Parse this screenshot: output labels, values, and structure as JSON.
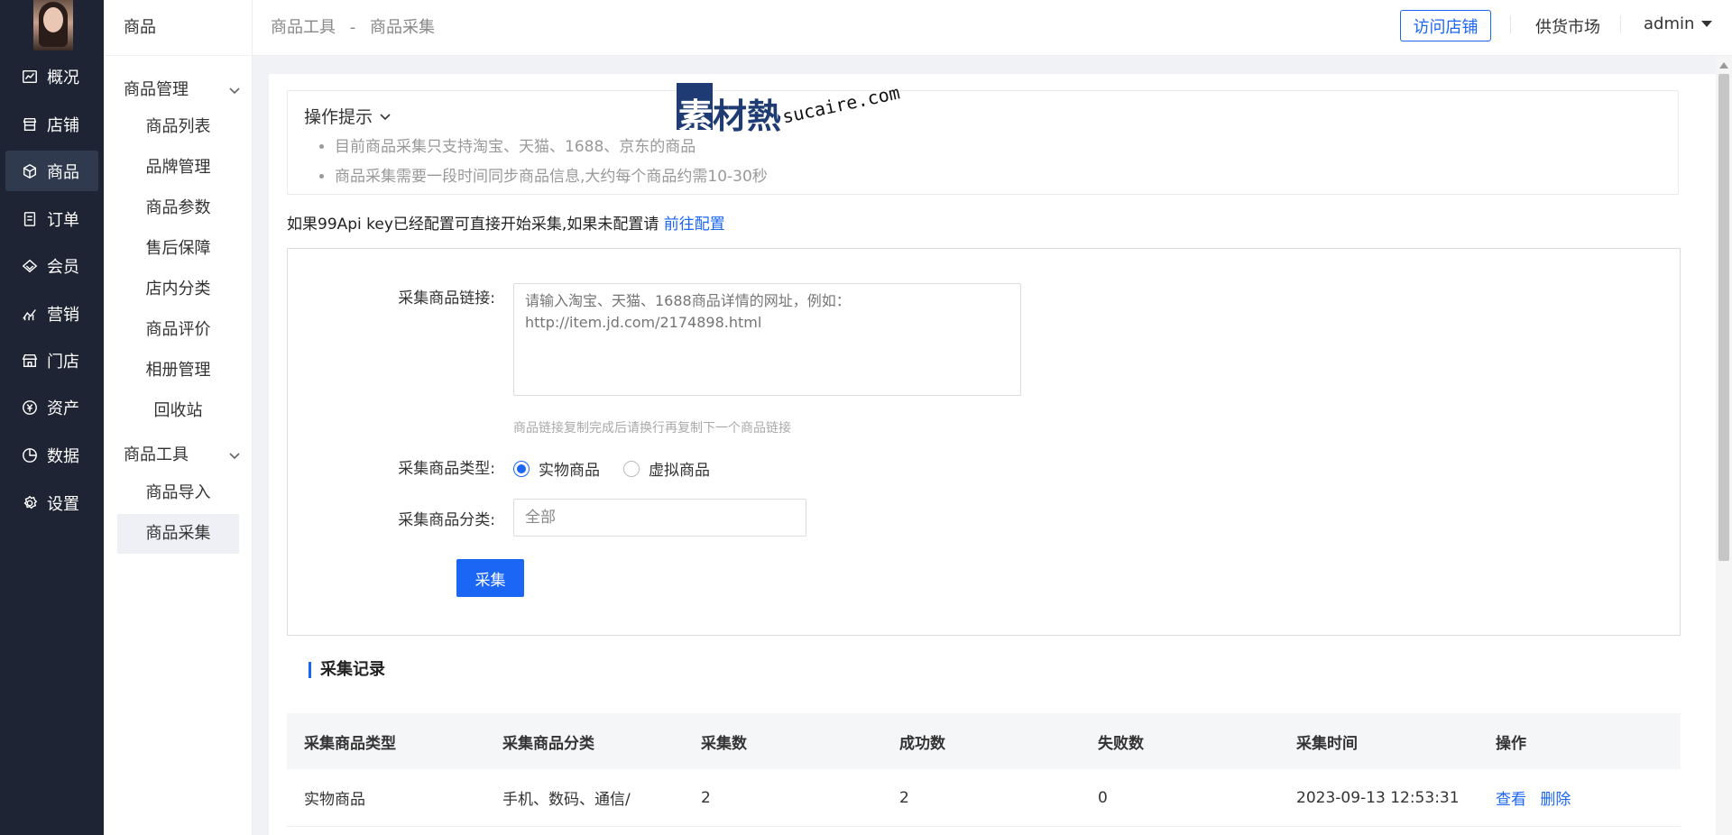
{
  "leftnav": {
    "items": [
      {
        "label": "概况",
        "icon": "chart-icon"
      },
      {
        "label": "店铺",
        "icon": "store-icon"
      },
      {
        "label": "商品",
        "icon": "box-icon"
      },
      {
        "label": "订单",
        "icon": "order-icon"
      },
      {
        "label": "会员",
        "icon": "diamond-icon"
      },
      {
        "label": "营销",
        "icon": "trend-icon"
      },
      {
        "label": "门店",
        "icon": "shop-icon"
      },
      {
        "label": "资产",
        "icon": "yen-icon"
      },
      {
        "label": "数据",
        "icon": "pie-icon"
      },
      {
        "label": "设置",
        "icon": "gear-icon"
      }
    ],
    "active_index": 2
  },
  "subnav": {
    "title": "商品",
    "groups": [
      {
        "label": "商品管理",
        "items": [
          "商品列表",
          "品牌管理",
          "商品参数",
          "售后保障",
          "店内分类",
          "商品评价",
          "相册管理",
          "回收站"
        ]
      },
      {
        "label": "商品工具",
        "items": [
          "商品导入",
          "商品采集"
        ]
      }
    ],
    "active_item": "商品采集"
  },
  "header": {
    "breadcrumb": [
      "商品工具",
      "-",
      "商品采集"
    ],
    "visit_store": "访问店铺",
    "supply_market": "供货市场",
    "user": "admin"
  },
  "tips": {
    "title": "操作提示",
    "items": [
      "目前商品采集只支持淘宝、天猫、1688、京东的商品",
      "商品采集需要一段时间同步商品信息,大约每个商品约需10-30秒"
    ]
  },
  "watermark": {
    "brand": "素材熱",
    "url": "sucaire.com"
  },
  "notice": {
    "text": "如果99Api key已经配置可直接开始采集,如果未配置请",
    "link": "前往配置"
  },
  "form": {
    "link_label": "采集商品链接:",
    "link_placeholder": "请输入淘宝、天猫、1688商品详情的网址，例如：http://item.jd.com/2174898.html",
    "link_hint": "商品链接复制完成后请换行再复制下一个商品链接",
    "type_label": "采集商品类型:",
    "type_options": [
      "实物商品",
      "虚拟商品"
    ],
    "type_selected": "实物商品",
    "category_label": "采集商品分类:",
    "category_value": "全部",
    "submit": "采集"
  },
  "records": {
    "title": "采集记录",
    "columns": [
      "采集商品类型",
      "采集商品分类",
      "采集数",
      "成功数",
      "失败数",
      "采集时间",
      "操作"
    ],
    "rows": [
      {
        "type": "实物商品",
        "category": "手机、数码、通信/",
        "count": "2",
        "success": "2",
        "fail": "0",
        "time": "2023-09-13 12:53:31",
        "actions": [
          "查看",
          "删除"
        ]
      }
    ]
  },
  "colors": {
    "primary": "#1b66f5",
    "nav_bg": "#1e2434",
    "nav_active": "#303a4f"
  }
}
